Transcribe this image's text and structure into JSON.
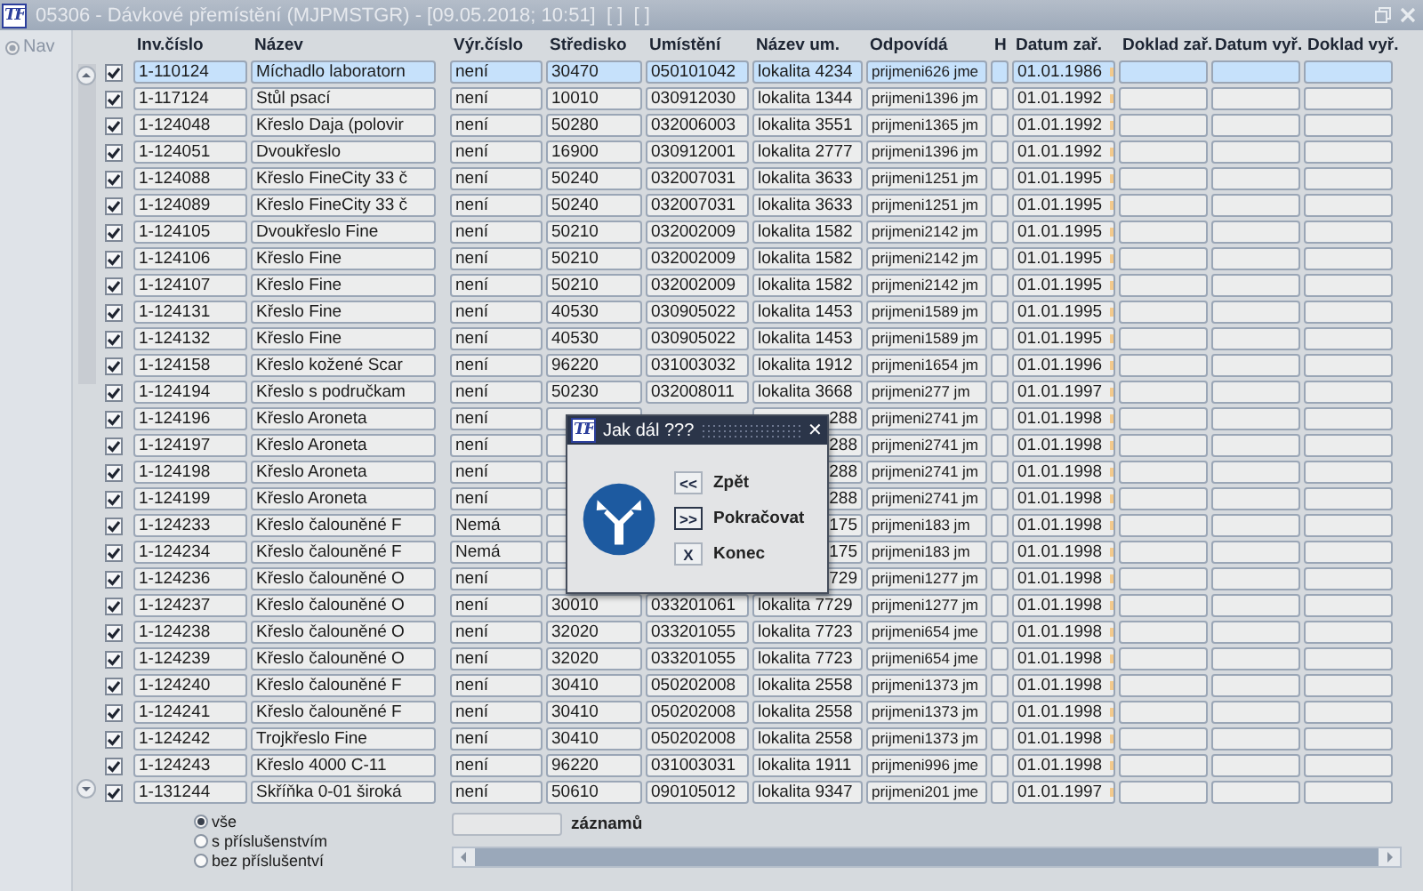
{
  "window": {
    "logo": "TF",
    "title": "05306 - Dávkové přemístění (MJPMSTGR) - [09.05.2018; 10:51]  [ ]  [ ]"
  },
  "sidebar": {
    "nav_button": "Nav"
  },
  "table": {
    "columns": [
      "Inv.číslo",
      "Název",
      "Výr.číslo",
      "Středisko",
      "Umístění",
      "Název um.",
      "Odpovídá",
      "H",
      "Datum zař.",
      "Doklad zař.",
      "Datum vyř.",
      "Doklad vyř."
    ],
    "rows": [
      {
        "checked": true,
        "selected": true,
        "covered": false,
        "cells": [
          "1-110124",
          "Míchadlo laboratorn",
          "není",
          "30470",
          "050101042",
          "lokalita 4234",
          "prijmeni626 jme",
          "",
          "01.01.1986"
        ]
      },
      {
        "checked": true,
        "selected": false,
        "covered": false,
        "cells": [
          "1-117124",
          "Stůl psací",
          "není",
          "10010",
          "030912030",
          "lokalita 1344",
          "prijmeni1396 jm",
          "",
          "01.01.1992"
        ]
      },
      {
        "checked": true,
        "selected": false,
        "covered": false,
        "cells": [
          "1-124048",
          "Křeslo Daja (polovir",
          "není",
          "50280",
          "032006003",
          "lokalita 3551",
          "prijmeni1365 jm",
          "",
          "01.01.1992"
        ]
      },
      {
        "checked": true,
        "selected": false,
        "covered": false,
        "cells": [
          "1-124051",
          "Dvoukřeslo",
          "není",
          "16900",
          "030912001",
          "lokalita 2777",
          "prijmeni1396 jm",
          "",
          "01.01.1992"
        ]
      },
      {
        "checked": true,
        "selected": false,
        "covered": false,
        "cells": [
          "1-124088",
          "Křeslo FineCity 33 č",
          "není",
          "50240",
          "032007031",
          "lokalita 3633",
          "prijmeni1251 jm",
          "",
          "01.01.1995"
        ]
      },
      {
        "checked": true,
        "selected": false,
        "covered": false,
        "cells": [
          "1-124089",
          "Křeslo FineCity 33 č",
          "není",
          "50240",
          "032007031",
          "lokalita 3633",
          "prijmeni1251 jm",
          "",
          "01.01.1995"
        ]
      },
      {
        "checked": true,
        "selected": false,
        "covered": false,
        "cells": [
          "1-124105",
          "Dvoukřeslo Fine",
          "není",
          "50210",
          "032002009",
          "lokalita 1582",
          "prijmeni2142 jm",
          "",
          "01.01.1995"
        ]
      },
      {
        "checked": true,
        "selected": false,
        "covered": false,
        "cells": [
          "1-124106",
          "Křeslo Fine",
          "není",
          "50210",
          "032002009",
          "lokalita 1582",
          "prijmeni2142 jm",
          "",
          "01.01.1995"
        ]
      },
      {
        "checked": true,
        "selected": false,
        "covered": false,
        "cells": [
          "1-124107",
          "Křeslo Fine",
          "není",
          "50210",
          "032002009",
          "lokalita 1582",
          "prijmeni2142 jm",
          "",
          "01.01.1995"
        ]
      },
      {
        "checked": true,
        "selected": false,
        "covered": false,
        "cells": [
          "1-124131",
          "Křeslo Fine",
          "není",
          "40530",
          "030905022",
          "lokalita 1453",
          "prijmeni1589 jm",
          "",
          "01.01.1995"
        ]
      },
      {
        "checked": true,
        "selected": false,
        "covered": false,
        "cells": [
          "1-124132",
          "Křeslo Fine",
          "není",
          "40530",
          "030905022",
          "lokalita 1453",
          "prijmeni1589 jm",
          "",
          "01.01.1995"
        ]
      },
      {
        "checked": true,
        "selected": false,
        "covered": false,
        "cells": [
          "1-124158",
          "Křeslo kožené Scar",
          "není",
          "96220",
          "031003032",
          "lokalita 1912",
          "prijmeni1654 jm",
          "",
          "01.01.1996"
        ]
      },
      {
        "checked": true,
        "selected": false,
        "covered": false,
        "cells": [
          "1-124194",
          "Křeslo s područkam",
          "není",
          "50230",
          "032008011",
          "lokalita 3668",
          "prijmeni277 jm",
          "",
          "01.01.1997"
        ]
      },
      {
        "checked": true,
        "selected": false,
        "covered": true,
        "cells": [
          "1-124196",
          "Křeslo Aroneta",
          "není",
          "",
          "",
          "288",
          "prijmeni2741 jm",
          "",
          "01.01.1998"
        ]
      },
      {
        "checked": true,
        "selected": false,
        "covered": true,
        "cells": [
          "1-124197",
          "Křeslo Aroneta",
          "není",
          "",
          "",
          "288",
          "prijmeni2741 jm",
          "",
          "01.01.1998"
        ]
      },
      {
        "checked": true,
        "selected": false,
        "covered": true,
        "cells": [
          "1-124198",
          "Křeslo Aroneta",
          "není",
          "",
          "",
          "288",
          "prijmeni2741 jm",
          "",
          "01.01.1998"
        ]
      },
      {
        "checked": true,
        "selected": false,
        "covered": true,
        "cells": [
          "1-124199",
          "Křeslo Aroneta",
          "není",
          "",
          "",
          "288",
          "prijmeni2741 jm",
          "",
          "01.01.1998"
        ]
      },
      {
        "checked": true,
        "selected": false,
        "covered": true,
        "cells": [
          "1-124233",
          "Křeslo čalouněné F",
          "Nemá",
          "",
          "",
          "175",
          "prijmeni183 jm",
          "",
          "01.01.1998"
        ]
      },
      {
        "checked": true,
        "selected": false,
        "covered": true,
        "cells": [
          "1-124234",
          "Křeslo čalouněné F",
          "Nemá",
          "",
          "",
          "175",
          "prijmeni183 jm",
          "",
          "01.01.1998"
        ]
      },
      {
        "checked": true,
        "selected": false,
        "covered": true,
        "cells": [
          "1-124236",
          "Křeslo čalouněné O",
          "není",
          "",
          "",
          "729",
          "prijmeni1277 jm",
          "",
          "01.01.1998"
        ]
      },
      {
        "checked": true,
        "selected": false,
        "covered": false,
        "cells": [
          "1-124237",
          "Křeslo čalouněné O",
          "není",
          "30010",
          "033201061",
          "lokalita 7729",
          "prijmeni1277 jm",
          "",
          "01.01.1998"
        ]
      },
      {
        "checked": true,
        "selected": false,
        "covered": false,
        "cells": [
          "1-124238",
          "Křeslo čalouněné O",
          "není",
          "32020",
          "033201055",
          "lokalita 7723",
          "prijmeni654 jme",
          "",
          "01.01.1998"
        ]
      },
      {
        "checked": true,
        "selected": false,
        "covered": false,
        "cells": [
          "1-124239",
          "Křeslo čalouněné O",
          "není",
          "32020",
          "033201055",
          "lokalita 7723",
          "prijmeni654 jme",
          "",
          "01.01.1998"
        ]
      },
      {
        "checked": true,
        "selected": false,
        "covered": false,
        "cells": [
          "1-124240",
          "Křeslo čalouněné F",
          "není",
          "30410",
          "050202008",
          "lokalita 2558",
          "prijmeni1373 jm",
          "",
          "01.01.1998"
        ]
      },
      {
        "checked": true,
        "selected": false,
        "covered": false,
        "cells": [
          "1-124241",
          "Křeslo čalouněné F",
          "není",
          "30410",
          "050202008",
          "lokalita 2558",
          "prijmeni1373 jm",
          "",
          "01.01.1998"
        ]
      },
      {
        "checked": true,
        "selected": false,
        "covered": false,
        "cells": [
          "1-124242",
          "Trojkřeslo Fine",
          "není",
          "30410",
          "050202008",
          "lokalita 2558",
          "prijmeni1373 jm",
          "",
          "01.01.1998"
        ]
      },
      {
        "checked": true,
        "selected": false,
        "covered": false,
        "cells": [
          "1-124243",
          "Křeslo 4000 C-11",
          "není",
          "96220",
          "031003031",
          "lokalita 1911",
          "prijmeni996 jme",
          "",
          "01.01.1998"
        ]
      },
      {
        "checked": true,
        "selected": false,
        "covered": false,
        "cells": [
          "1-131244",
          "Skříňka 0-01 široká",
          "není",
          "50610",
          "090105012",
          "lokalita 9347",
          "prijmeni201 jme",
          "",
          "01.01.1997"
        ]
      }
    ]
  },
  "filter": {
    "options": [
      {
        "label": "vše",
        "selected": true
      },
      {
        "label": "s příslušenstvím",
        "selected": false
      },
      {
        "label": "bez příslušentví",
        "selected": false
      }
    ]
  },
  "record_count": {
    "label": "záznamů"
  },
  "dialog": {
    "logo": "TF",
    "title": "Jak dál ???",
    "close": "✕",
    "buttons": [
      {
        "key": "<<",
        "label": "Zpět",
        "focused": false
      },
      {
        "key": ">>",
        "label": "Pokračovat",
        "focused": true
      },
      {
        "key": "X",
        "label": "Konec",
        "focused": false
      }
    ]
  }
}
